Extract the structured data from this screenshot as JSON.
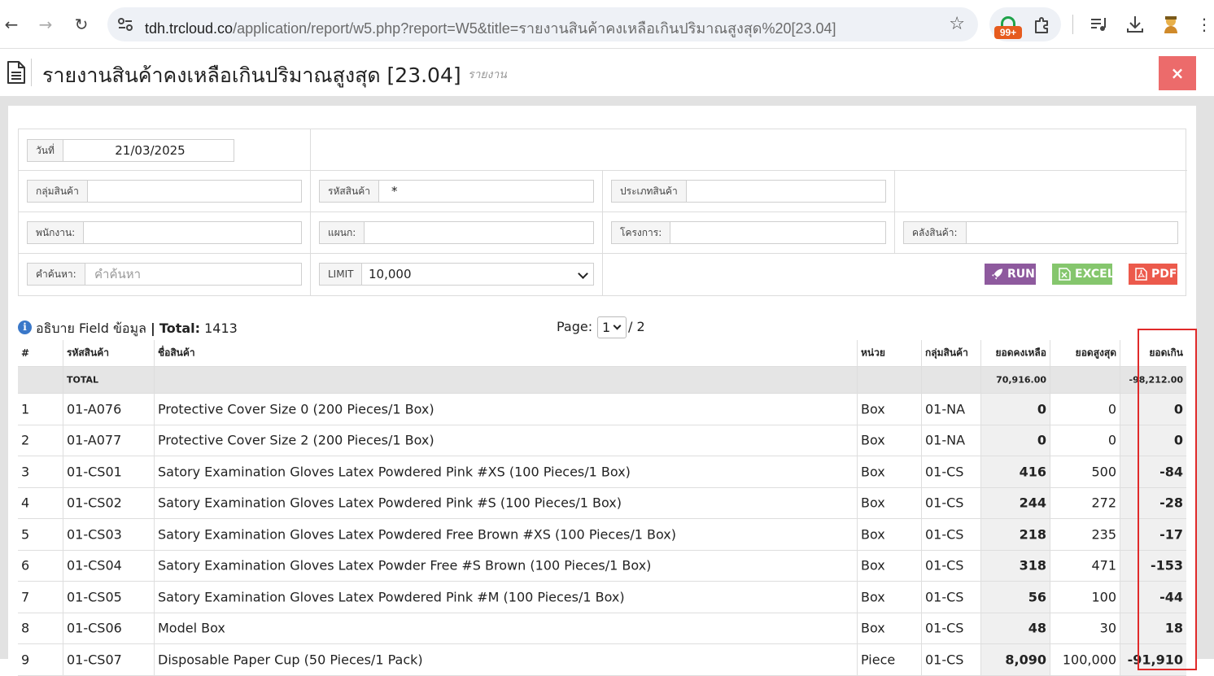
{
  "browser": {
    "url_host": "tdh.trcloud.co",
    "url_path": "/application/report/w5.php?report=W5&title=รายงานสินค้าคงเหลือเกินปริมาณสูงสุด%20[23.04]",
    "extension_badge": "99+"
  },
  "header": {
    "title": "รายงานสินค้าคงเหลือเกินปริมาณสูงสุด [23.04]",
    "subtitle": "รายงาน",
    "close_label": "×"
  },
  "filters": {
    "date": {
      "label": "วันที่",
      "value": "21/03/2025"
    },
    "product_group": {
      "label": "กลุ่มสินค้า",
      "value": ""
    },
    "product_code": {
      "label": "รหัสสินค้า",
      "value": "*"
    },
    "product_type": {
      "label": "ประเภทสินค้า",
      "value": ""
    },
    "employee": {
      "label": "พนักงาน:",
      "value": ""
    },
    "department": {
      "label": "แผนก:",
      "value": ""
    },
    "project": {
      "label": "โครงการ:",
      "value": ""
    },
    "warehouse": {
      "label": "คลังสินค้า:",
      "value": ""
    },
    "keyword": {
      "label": "คำค้นหา:",
      "placeholder": "คำค้นหา"
    },
    "limit": {
      "label": "LIMIT",
      "value": "10,000"
    }
  },
  "actions": {
    "run": "RUN",
    "excel": "EXCEL",
    "pdf": "PDF"
  },
  "info": {
    "field_text": "อธิบาย Field ข้อมูล",
    "separator": "|",
    "total_label": "Total:",
    "total_value": "1413"
  },
  "pager": {
    "label": "Page:",
    "current": "1",
    "of": "/ 2"
  },
  "table": {
    "headers": [
      "#",
      "รหัสสินค้า",
      "ชื่อสินค้า",
      "หน่วย",
      "กลุ่มสินค้า",
      "ยอดคงเหลือ",
      "ยอดสูงสุด",
      "ยอดเกิน"
    ],
    "total_row": {
      "label": "TOTAL",
      "balance": "70,916.00",
      "max": "",
      "excess": "-98,212.00"
    },
    "rows": [
      {
        "no": "1",
        "code": "01-A076",
        "name": "Protective Cover Size 0 (200 Pieces/1 Box)",
        "unit": "Box",
        "group": "01-NA",
        "balance": "0",
        "max": "0",
        "excess": "0"
      },
      {
        "no": "2",
        "code": "01-A077",
        "name": "Protective Cover Size 2 (200 Pieces/1 Box)",
        "unit": "Box",
        "group": "01-NA",
        "balance": "0",
        "max": "0",
        "excess": "0"
      },
      {
        "no": "3",
        "code": "01-CS01",
        "name": "Satory Examination Gloves Latex Powdered Pink #XS (100 Pieces/1 Box)",
        "unit": "Box",
        "group": "01-CS",
        "balance": "416",
        "max": "500",
        "excess": "-84"
      },
      {
        "no": "4",
        "code": "01-CS02",
        "name": "Satory Examination Gloves Latex Powdered Pink #S (100 Pieces/1 Box)",
        "unit": "Box",
        "group": "01-CS",
        "balance": "244",
        "max": "272",
        "excess": "-28"
      },
      {
        "no": "5",
        "code": "01-CS03",
        "name": "Satory Examination Gloves Latex Powdered Free Brown #XS (100 Pieces/1 Box)",
        "unit": "Box",
        "group": "01-CS",
        "balance": "218",
        "max": "235",
        "excess": "-17"
      },
      {
        "no": "6",
        "code": "01-CS04",
        "name": "Satory Examination Gloves Latex Powder Free #S Brown (100 Pieces/1 Box)",
        "unit": "Box",
        "group": "01-CS",
        "balance": "318",
        "max": "471",
        "excess": "-153"
      },
      {
        "no": "7",
        "code": "01-CS05",
        "name": "Satory Examination Gloves Latex Powdered Pink #M (100 Pieces/1 Box)",
        "unit": "Box",
        "group": "01-CS",
        "balance": "56",
        "max": "100",
        "excess": "-44"
      },
      {
        "no": "8",
        "code": "01-CS06",
        "name": "Model Box",
        "unit": "Box",
        "group": "01-CS",
        "balance": "48",
        "max": "30",
        "excess": "18"
      },
      {
        "no": "9",
        "code": "01-CS07",
        "name": "Disposable Paper Cup (50 Pieces/1 Pack)",
        "unit": "Piece",
        "group": "01-CS",
        "balance": "8,090",
        "max": "100,000",
        "excess": "-91,910"
      }
    ]
  },
  "colors": {
    "run": "#8e5a9e",
    "excel": "#85c66d",
    "pdf": "#ec5a4c",
    "close": "#ec6b6b",
    "highlight": "#e02a2a"
  }
}
